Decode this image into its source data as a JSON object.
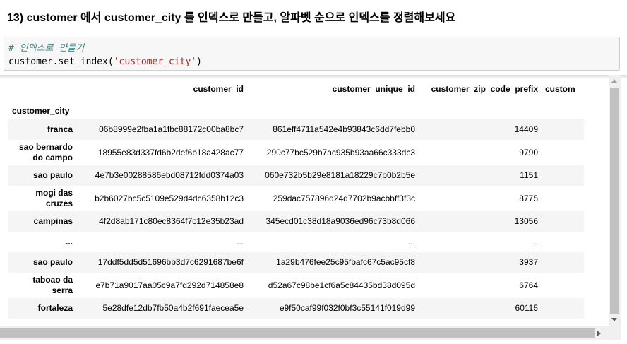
{
  "heading": "13) customer 에서 customer_city 를 인덱스로 만들고, 알파벳 순으로 인덱스를 정렬해보세요",
  "code": {
    "comment": "# 인덱스로 만들기",
    "call_prefix": "customer.set_index(",
    "call_arg": "'customer_city'",
    "call_suffix": ")"
  },
  "table": {
    "columns": [
      "customer_id",
      "customer_unique_id",
      "customer_zip_code_prefix",
      "custom"
    ],
    "index_name": "customer_city",
    "rows": [
      {
        "index": "franca",
        "values": [
          "06b8999e2fba1a1fbc88172c00ba8bc7",
          "861eff4711a542e4b93843c6dd7febb0",
          "14409"
        ]
      },
      {
        "index": "sao bernardo do campo",
        "values": [
          "18955e83d337fd6b2def6b18a428ac77",
          "290c77bc529b7ac935b93aa66c333dc3",
          "9790"
        ]
      },
      {
        "index": "sao paulo",
        "values": [
          "4e7b3e00288586ebd08712fdd0374a03",
          "060e732b5b29e8181a18229c7b0b2b5e",
          "1151"
        ]
      },
      {
        "index": "mogi das cruzes",
        "values": [
          "b2b6027bc5c5109e529d4dc6358b12c3",
          "259dac757896d24d7702b9acbbff3f3c",
          "8775"
        ]
      },
      {
        "index": "campinas",
        "values": [
          "4f2d8ab171c80ec8364f7c12e35b23ad",
          "345ecd01c38d18a9036ed96c73b8d066",
          "13056"
        ]
      },
      {
        "index": "...",
        "values": [
          "...",
          "...",
          "..."
        ]
      },
      {
        "index": "sao paulo",
        "values": [
          "17ddf5dd5d51696bb3d7c6291687be6f",
          "1a29b476fee25c95fbafc67c5ac95cf8",
          "3937"
        ]
      },
      {
        "index": "taboao da serra",
        "values": [
          "e7b71a9017aa05c9a7fd292d714858e8",
          "d52a67c98be1cf6a5c84435bd38d095d",
          "6764"
        ]
      },
      {
        "index": "fortaleza",
        "values": [
          "5e28dfe12db7fb50a4b2f691faecea5e",
          "e9f50caf99f032f0bf3c55141f019d99",
          "60115"
        ]
      }
    ]
  }
}
